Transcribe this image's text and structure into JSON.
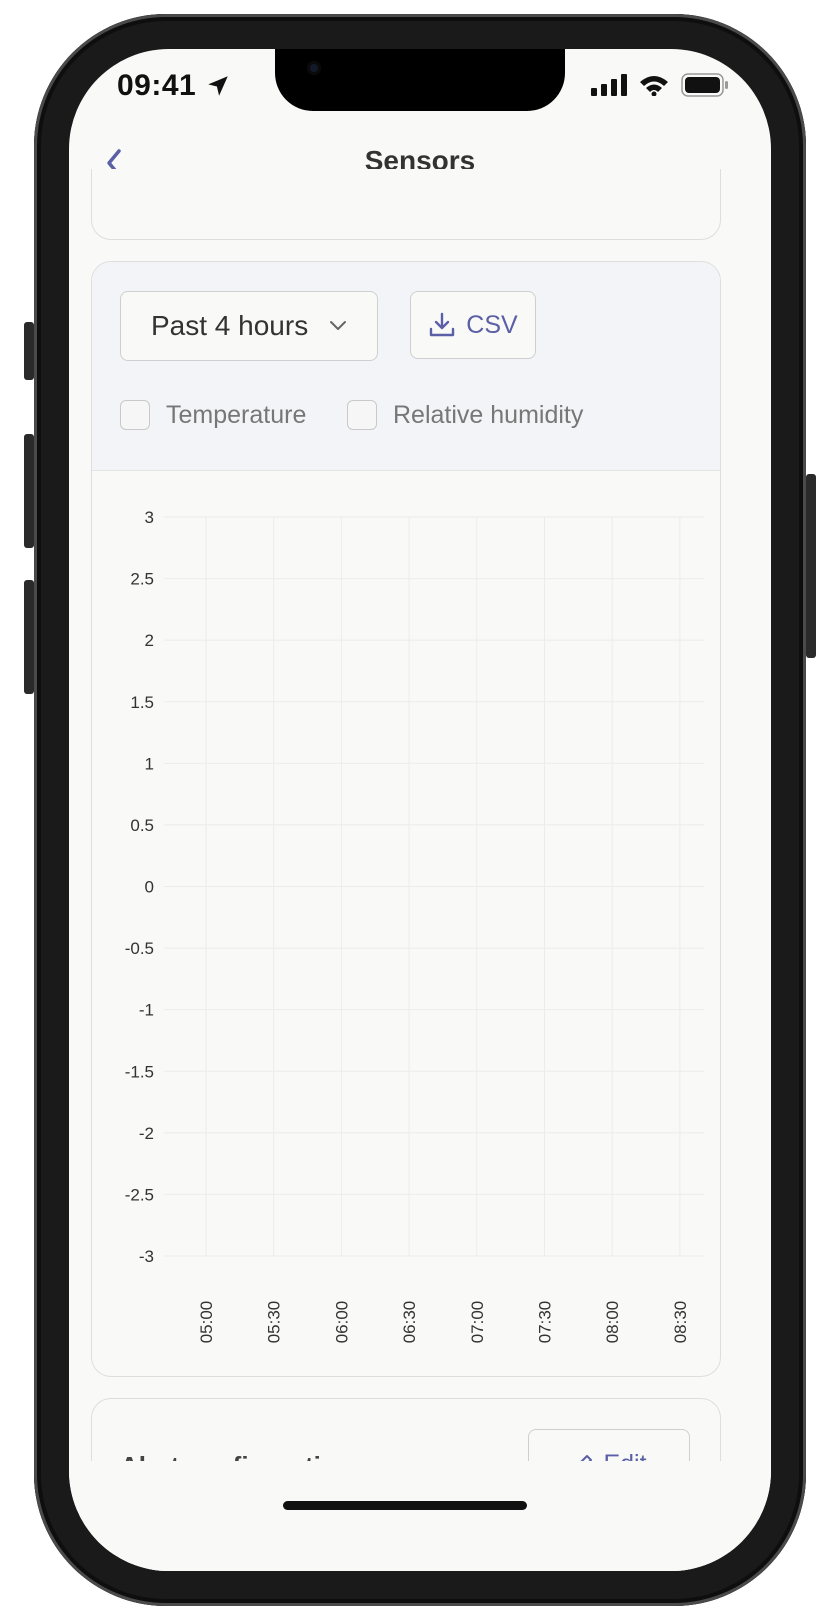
{
  "status_bar": {
    "time": "09:41"
  },
  "nav": {
    "title": "Sensors"
  },
  "controls": {
    "range_selected": "Past 4 hours",
    "csv_label": "CSV",
    "checkboxes": [
      {
        "label": "Temperature",
        "checked": false
      },
      {
        "label": "Relative humidity",
        "checked": false
      }
    ]
  },
  "chart_data": {
    "type": "line",
    "series": [],
    "ylim": [
      -3,
      3
    ],
    "yticks": [
      "3",
      "2.5",
      "2",
      "1.5",
      "1",
      "0.5",
      "0",
      "-0.5",
      "-1",
      "-1.5",
      "-2",
      "-2.5",
      "-3"
    ],
    "xticks": [
      "05:00",
      "05:30",
      "06:00",
      "06:30",
      "07:00",
      "07:30",
      "08:00",
      "08:30"
    ],
    "grid": true
  },
  "alerts": {
    "title": "Alert configuration",
    "edit_label": "Edit"
  },
  "colors": {
    "accent": "#5b5fa6",
    "background": "#f9f9f8",
    "panel": "#f3f4f7",
    "grid": "#ececec"
  }
}
